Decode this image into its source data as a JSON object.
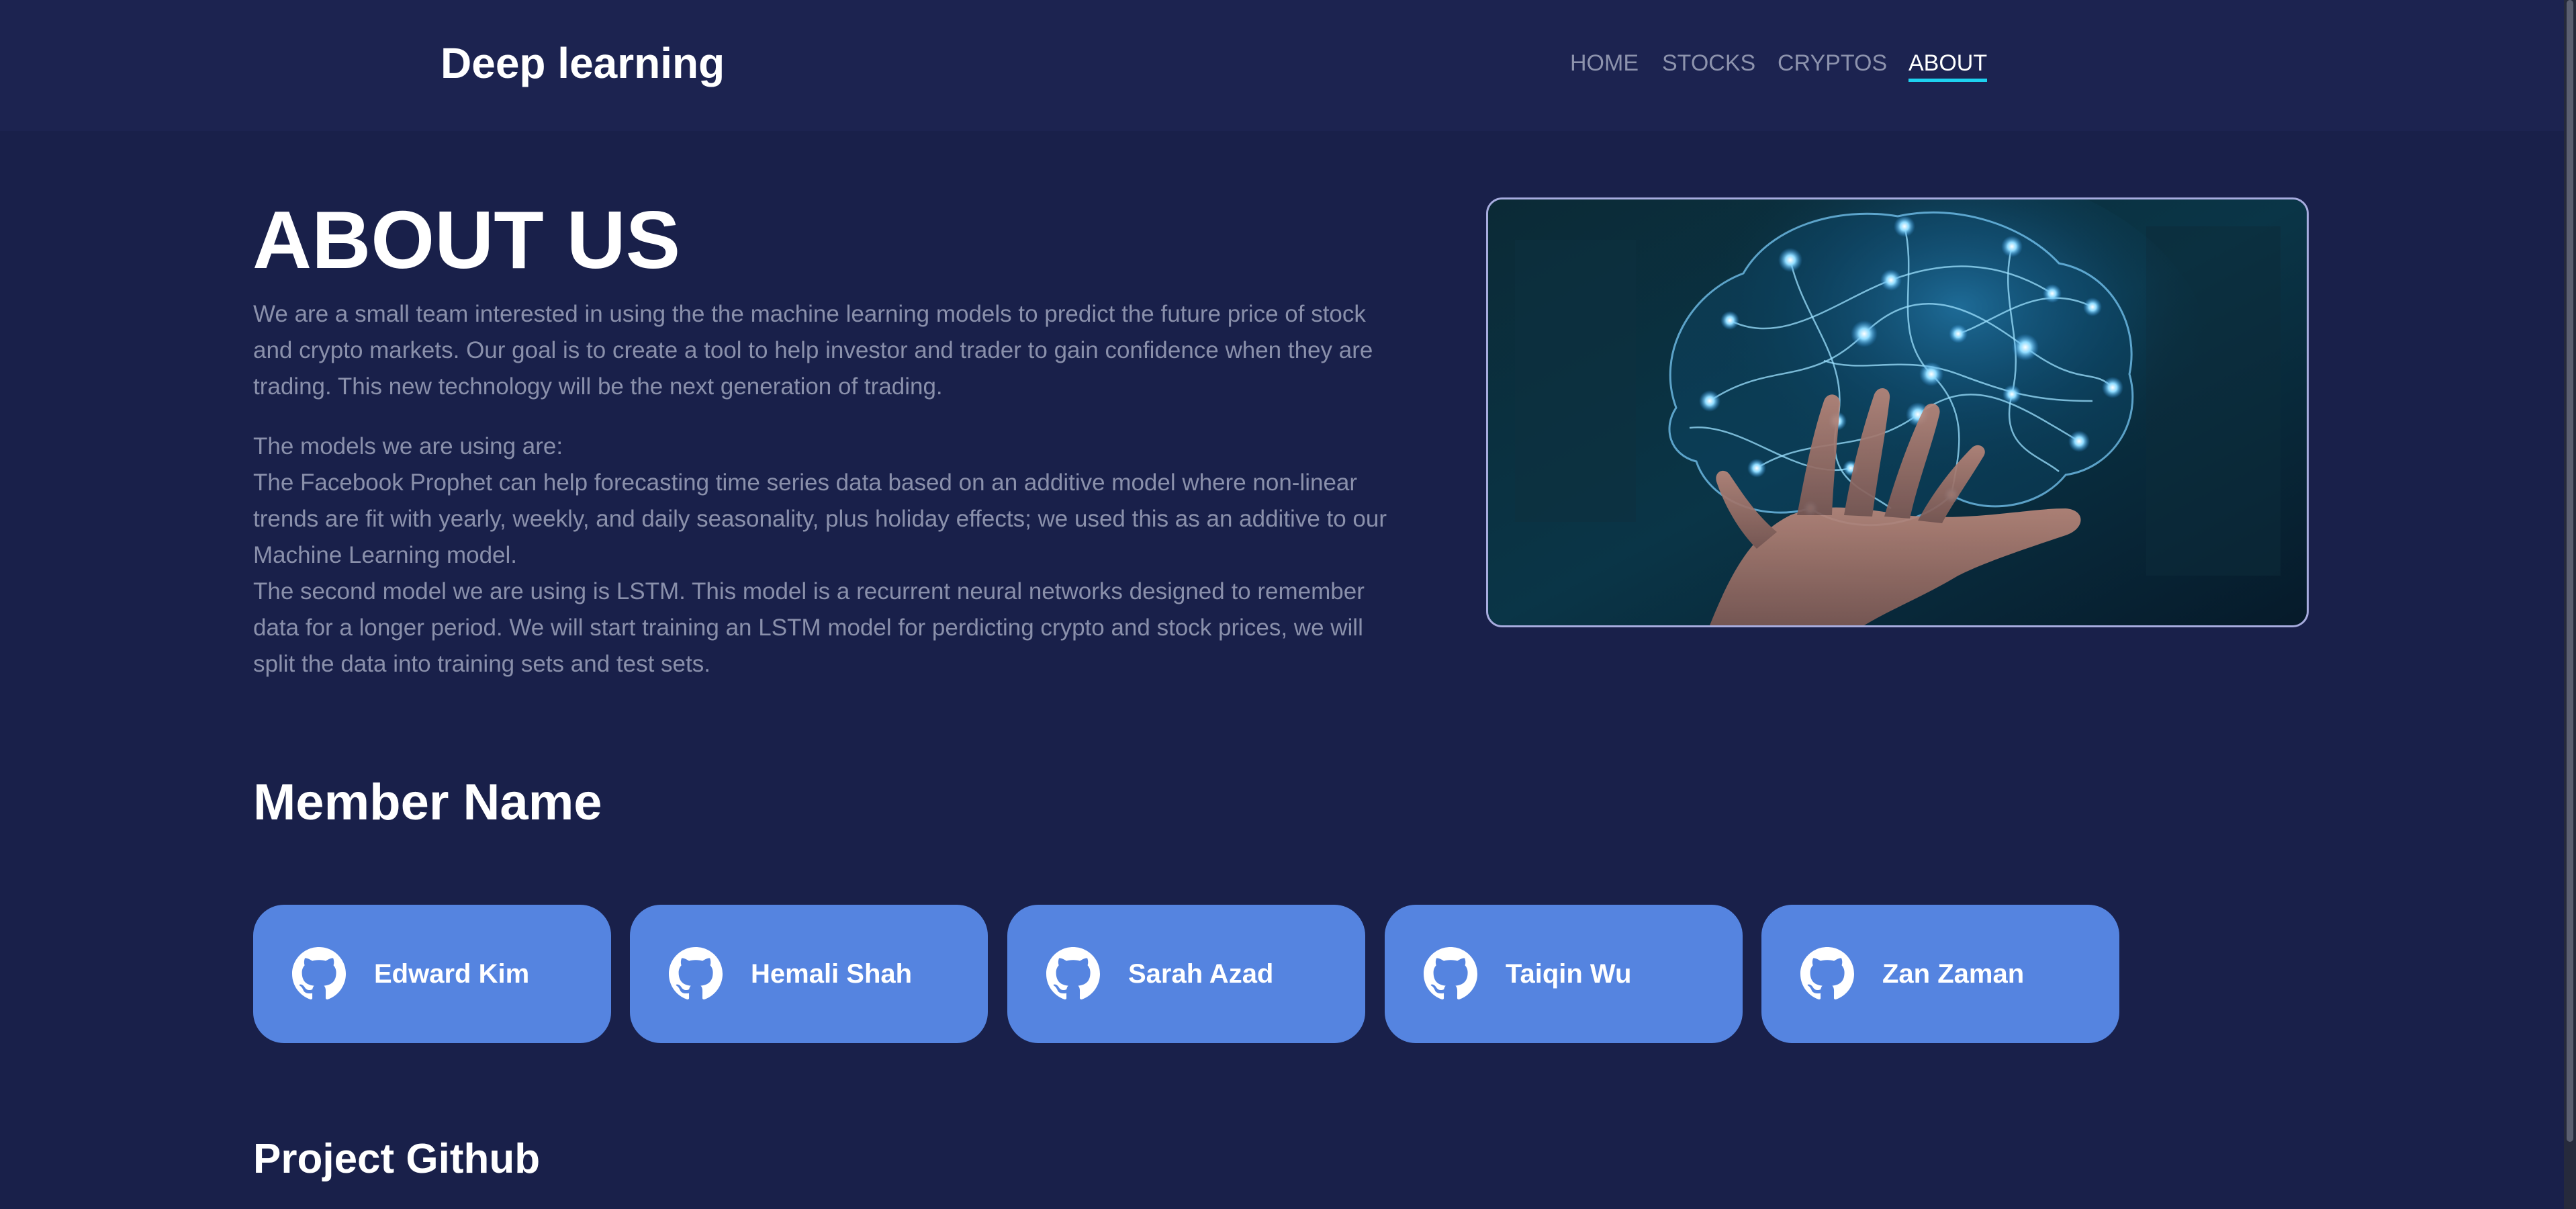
{
  "header": {
    "brand": "Deep learning",
    "nav": [
      {
        "label": "HOME",
        "active": false
      },
      {
        "label": "STOCKS",
        "active": false
      },
      {
        "label": "CRYPTOS",
        "active": false
      },
      {
        "label": "ABOUT",
        "active": true
      }
    ]
  },
  "about": {
    "title": "ABOUT US",
    "intro": "We are a small team interested in using the the machine learning models to predict the future price of stock and crypto markets. Our goal is to create a tool to help investor and trader to gain confidence when they are trading. This new technology will be the next generation of trading.",
    "models_heading": "The models we are using are:",
    "model_prophet": "The Facebook Prophet can help forecasting time series data based on an additive model where non-linear trends are fit with yearly, weekly, and daily seasonality, plus holiday effects; we used this as an additive to our Machine Learning model.",
    "model_lstm": "The second model we are using is LSTM. This model is a recurrent neural networks designed to remember data for a longer period. We will start training an LSTM model for perdicting crypto and stock prices, we will split the data into training sets and test sets."
  },
  "members": {
    "title": "Member Name",
    "icon": "github-icon",
    "list": [
      {
        "name": "Edward Kim"
      },
      {
        "name": "Hemali Shah"
      },
      {
        "name": "Sarah Azad"
      },
      {
        "name": "Taiqin Wu"
      },
      {
        "name": "Zan Zaman"
      }
    ]
  },
  "project": {
    "title": "Project Github"
  },
  "colors": {
    "page_background": "#19204a",
    "navbar_background": "#1c2350",
    "nav_active_underline": "#1ed2f0",
    "card_background": "#5584e0",
    "body_text": "#8a90ab"
  }
}
